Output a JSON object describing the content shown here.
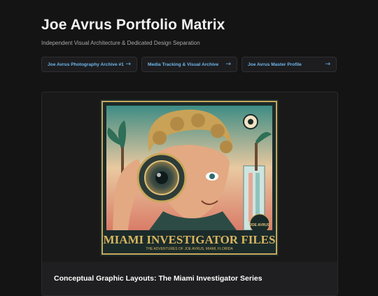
{
  "header": {
    "title": "Joe Avrus Portfolio Matrix",
    "subtitle": "Independent Visual Architecture & Dedicated Design Separation"
  },
  "nav": [
    {
      "label": "Joe Avrus Photography Archive #1",
      "icon": "arrow-right-icon",
      "arrow": "→"
    },
    {
      "label": "Media Tracking & Visual Archive",
      "icon": "arrow-right-icon",
      "arrow": "→"
    },
    {
      "label": "Joe Avrus Master Profile",
      "icon": "arrow-right-icon",
      "arrow": "→"
    }
  ],
  "card": {
    "heading": "Conceptual Graphic Layouts: The Miami Investigator Series",
    "artwork": {
      "banner_title": "MIAMI INVESTIGATOR FILES",
      "banner_sub": "THE ADVENTURES OF JOE AVRUS, MIAMI, FLORIDA",
      "signature": "JOE AVRUS"
    }
  },
  "colors": {
    "background": "#141414",
    "accent_link": "#6fb8ee",
    "card": "#191919"
  }
}
